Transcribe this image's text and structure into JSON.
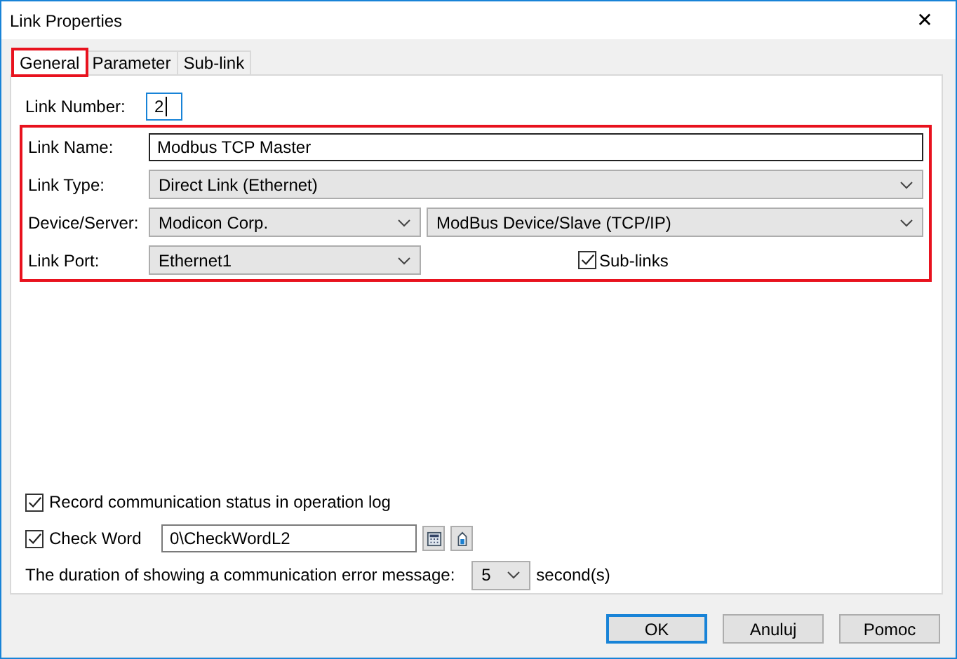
{
  "window": {
    "title": "Link Properties",
    "close": "✕"
  },
  "tabs": [
    {
      "label": "General",
      "selected": true,
      "highlighted": true
    },
    {
      "label": "Parameter",
      "selected": false,
      "highlighted": false
    },
    {
      "label": "Sub-link",
      "selected": false,
      "highlighted": false
    }
  ],
  "link_number": {
    "label": "Link Number:",
    "value": "2"
  },
  "link_name": {
    "label": "Link Name:",
    "value": "Modbus TCP Master"
  },
  "link_type": {
    "label": "Link Type:",
    "value": "Direct Link (Ethernet)"
  },
  "device_server": {
    "label": "Device/Server:",
    "vendor": "Modicon Corp.",
    "device": "ModBus Device/Slave (TCP/IP)"
  },
  "link_port": {
    "label": "Link Port:",
    "value": "Ethernet1"
  },
  "sub_links": {
    "label": "Sub-links",
    "checked": true
  },
  "record_status": {
    "label": "Record communication status in operation log",
    "checked": true
  },
  "check_word": {
    "label": "Check Word",
    "checked": true,
    "value": "0\\CheckWordL2"
  },
  "error_duration": {
    "label": "The duration of showing a communication error message:",
    "value": "5",
    "unit": "second(s)"
  },
  "buttons": [
    {
      "label": "OK",
      "default": true
    },
    {
      "label": "Anuluj",
      "default": false
    },
    {
      "label": "Pomoc",
      "default": false
    }
  ]
}
